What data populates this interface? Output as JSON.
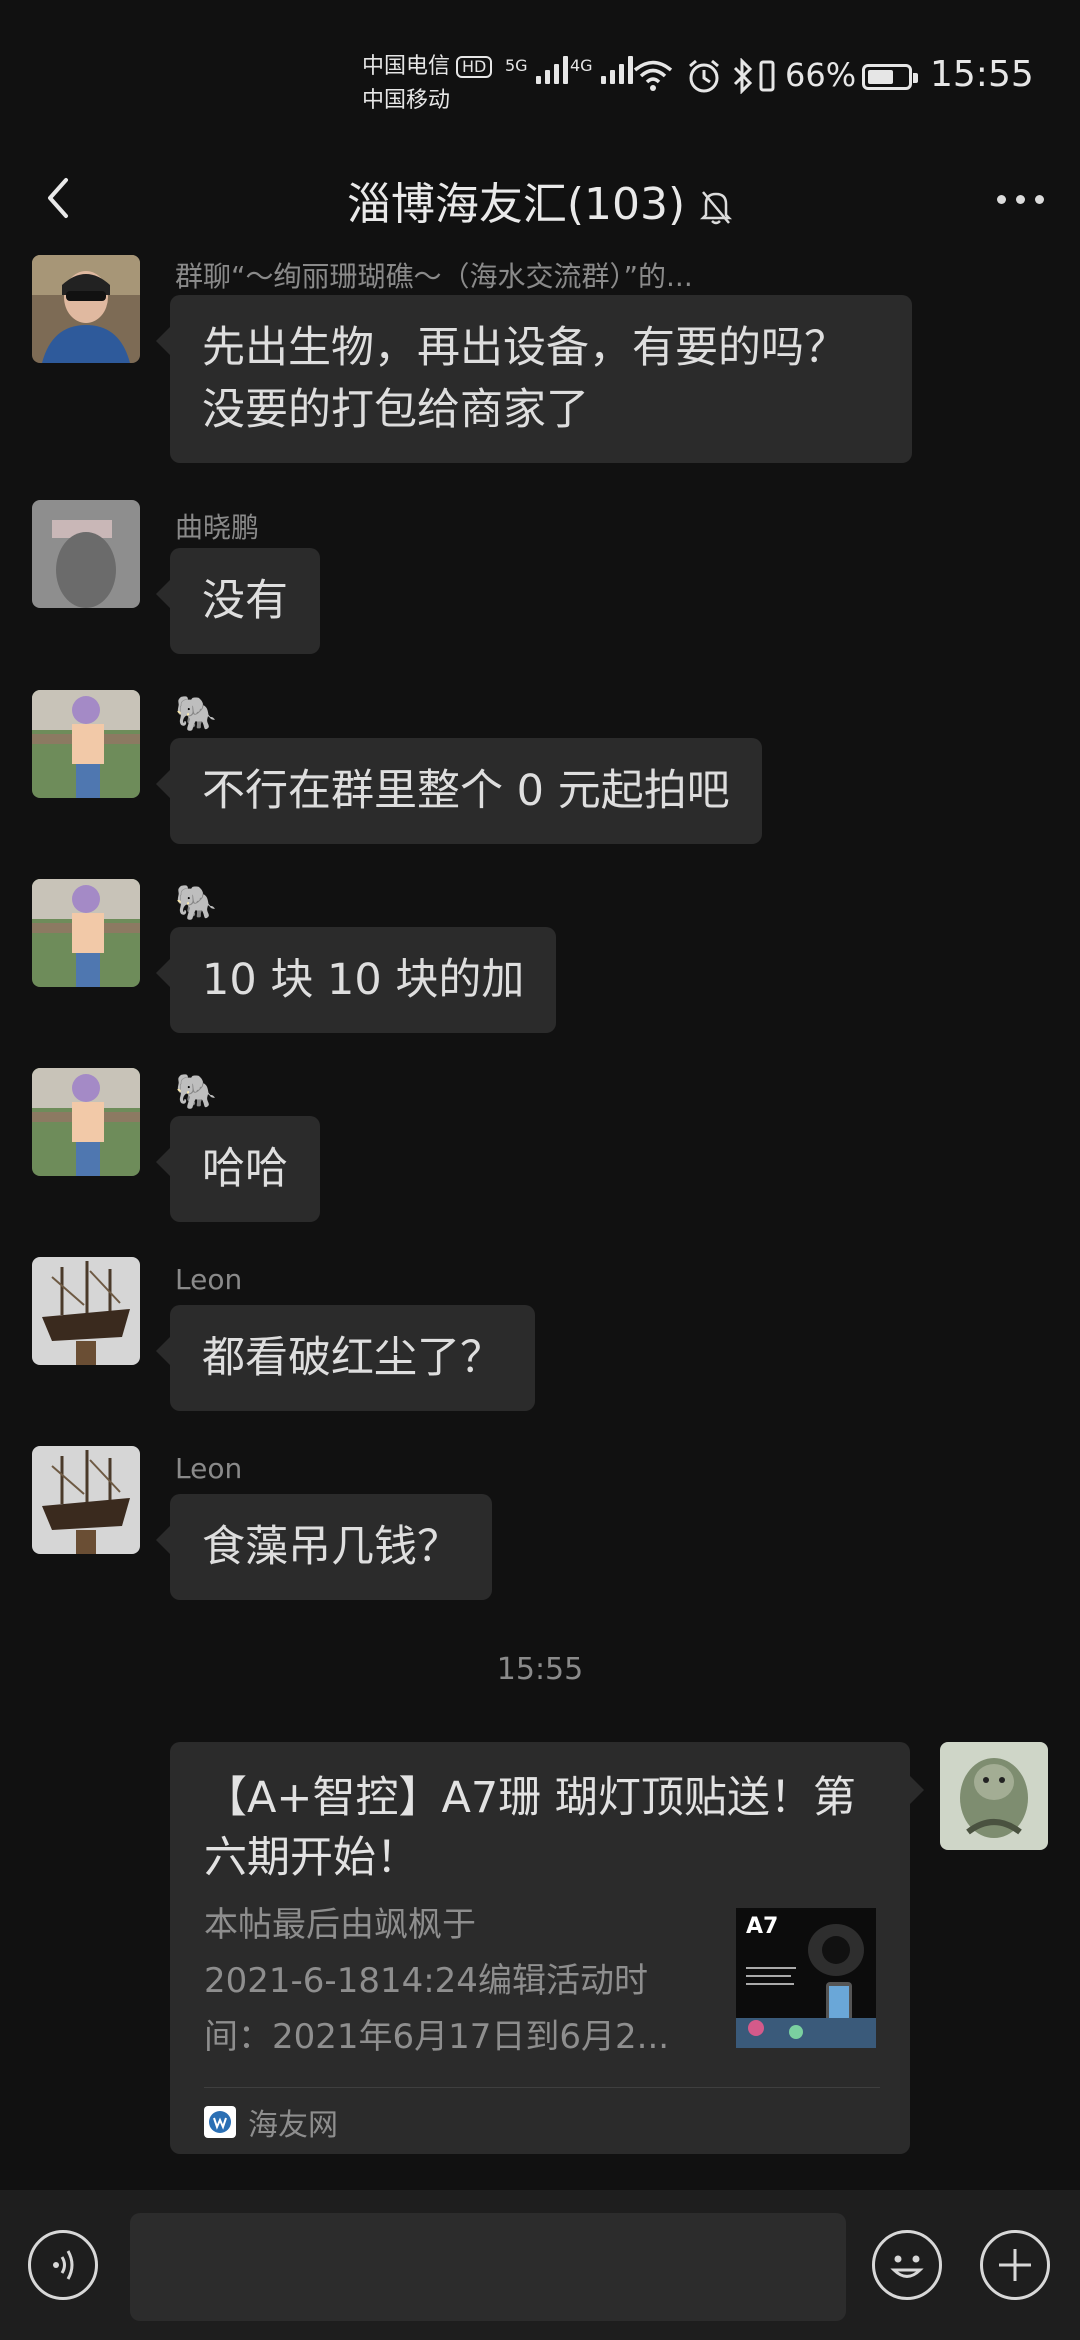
{
  "status_bar": {
    "carrier1": "中国电信",
    "hd_badge": "HD",
    "carrier2": "中国移动",
    "net1": "5G",
    "net2": "4G",
    "battery_percent": "66%",
    "battery_level": 0.66,
    "time": "15:55",
    "icons": [
      "wifi-icon",
      "alarm-icon",
      "bluetooth-icon",
      "vibrate-icon",
      "battery-icon"
    ]
  },
  "header": {
    "title": "淄博海友汇(103)",
    "back_icon": "back-arrow-icon",
    "mute_icon": "bell-off-icon",
    "more_icon": "more-dots-icon"
  },
  "messages": [
    {
      "sender": "群聊“～绚丽珊瑚礁～（海水交流群）”的...",
      "text": "先出生物，再出设备，有要的吗？\n没要的打包给商家了"
    },
    {
      "sender": "曲晓鹏",
      "text": "没有"
    },
    {
      "sender": "🐘",
      "text": "不行在群里整个 0 元起拍吧"
    },
    {
      "sender": "🐘",
      "text": "10 块 10 块的加"
    },
    {
      "sender": "🐘",
      "text": "哈哈"
    },
    {
      "sender": "Leon",
      "text": "都看破红尘了？"
    },
    {
      "sender": "Leon",
      "text": "食藻吊几钱？"
    }
  ],
  "timestamp": "15:55",
  "card": {
    "title": "【A+智控】A7珊 瑚灯顶贴送！第六期开始！",
    "desc_line1": "本帖最后由飒枫于",
    "desc_line2": "2021-6-1814:24编辑活动时",
    "desc_line3": "间：2021年6月17日到6月2...",
    "thumb_label": "A7",
    "source": "海友网"
  },
  "input_bar": {
    "voice_icon": "voice-icon",
    "emoji_icon": "emoji-icon",
    "plus_icon": "plus-icon",
    "input_value": ""
  }
}
